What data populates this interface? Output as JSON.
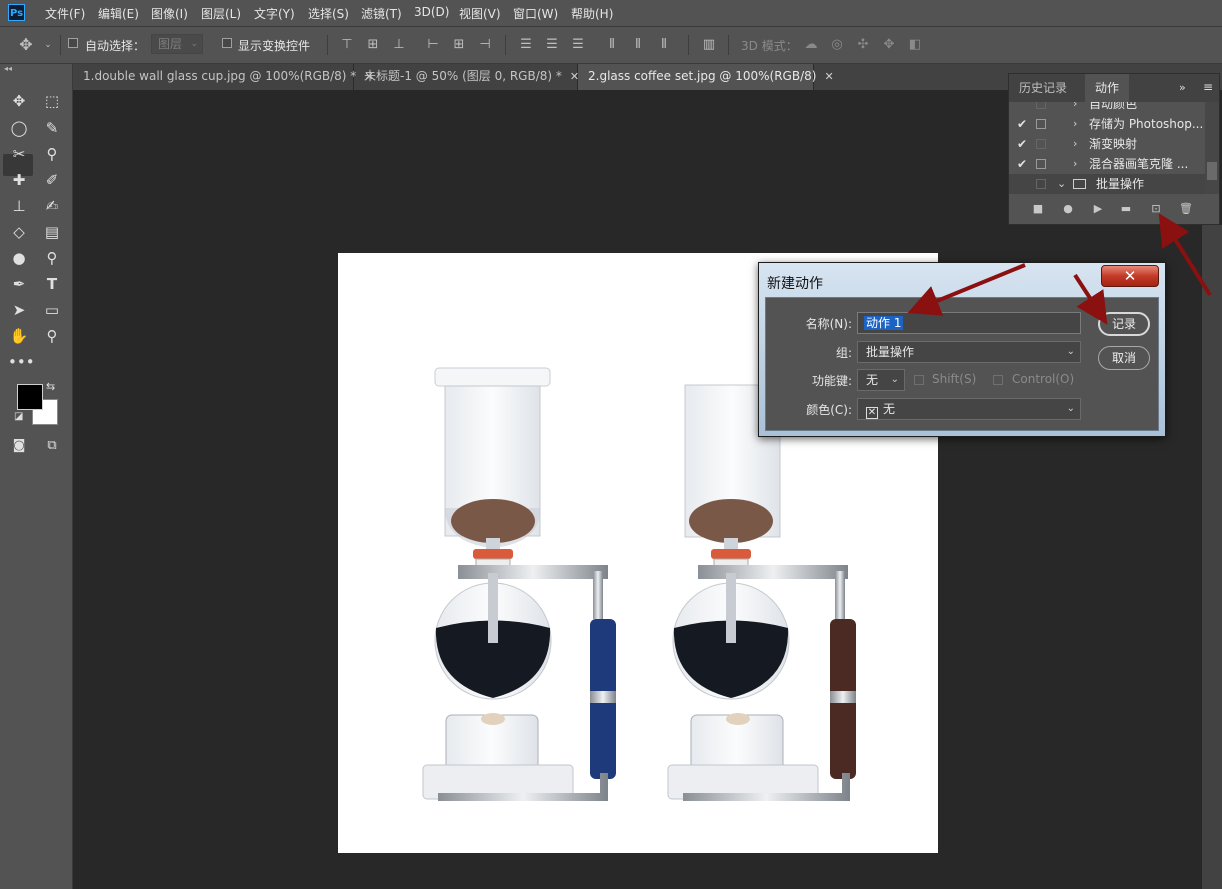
{
  "app": {
    "logo": "Ps"
  },
  "menu": [
    "文件(F)",
    "编辑(E)",
    "图像(I)",
    "图层(L)",
    "文字(Y)",
    "选择(S)",
    "滤镜(T)",
    "3D(D)",
    "视图(V)",
    "窗口(W)",
    "帮助(H)"
  ],
  "options": {
    "auto_select_label": "自动选择：",
    "auto_select_value": "图层",
    "show_transform_label": "显示变换控件",
    "mode_3d_label": "3D 模式："
  },
  "tabs": [
    {
      "label": "1.double wall glass cup.jpg @ 100%(RGB/8) *",
      "close": "✕"
    },
    {
      "label": "未标题-1 @ 50% (图层 0, RGB/8) *",
      "close": "✕"
    },
    {
      "label": "2.glass coffee set.jpg @ 100%(RGB/8)",
      "close": "✕"
    }
  ],
  "actions_panel": {
    "tab_history": "历史记录",
    "tab_actions": "动作",
    "rows": [
      {
        "check": "",
        "label": "自动颜色"
      },
      {
        "check": "✔",
        "label": "存储为 Photoshop..."
      },
      {
        "check": "✔",
        "label": "渐变映射"
      },
      {
        "check": "✔",
        "label": "混合器画笔克隆 ..."
      },
      {
        "check": "",
        "label": "批量操作"
      }
    ]
  },
  "dialog": {
    "title": "新建动作",
    "close": "✕",
    "name_label": "名称(N):",
    "name_value": "动作 1",
    "group_label": "组:",
    "group_value": "批量操作",
    "fkey_label": "功能键:",
    "fkey_value": "无",
    "shift_label": "Shift(S)",
    "control_label": "Control(O)",
    "color_label": "颜色(C):",
    "color_value": "无",
    "record_button": "记录",
    "cancel_button": "取消"
  },
  "colors": {
    "accent_arrow": "#8b1010",
    "highlight": "#1d63c4"
  }
}
